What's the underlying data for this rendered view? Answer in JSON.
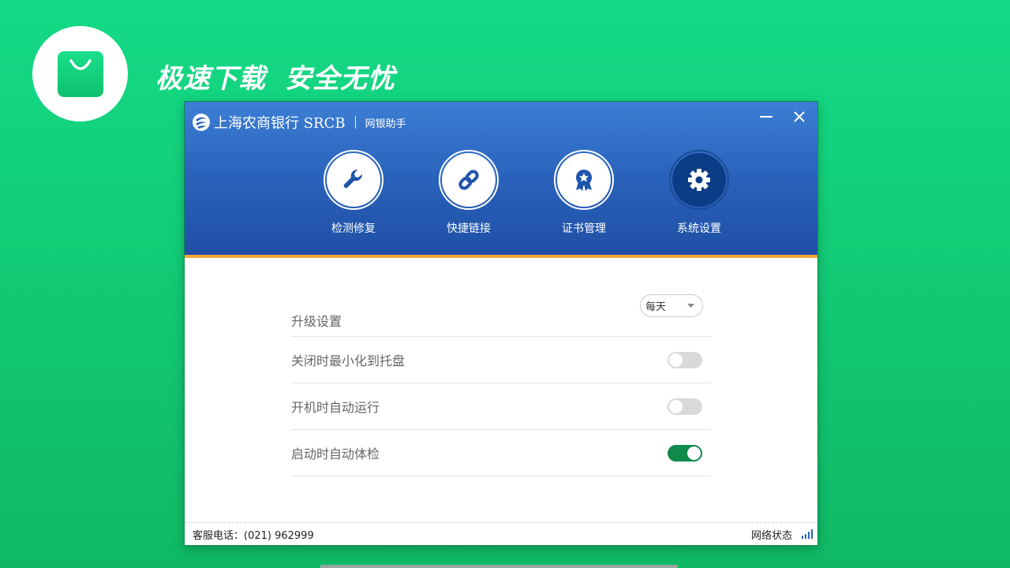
{
  "promo": {
    "slogan_left": "极速下载",
    "slogan_right": "安全无忧"
  },
  "window": {
    "brand_name": "上海农商银行 SRCB",
    "app_name": "网银助手",
    "minimize_label": "—",
    "close_label": "✕"
  },
  "nav": {
    "items": [
      {
        "label": "检测修复",
        "icon": "wrench-icon"
      },
      {
        "label": "快捷链接",
        "icon": "link-icon"
      },
      {
        "label": "证书管理",
        "icon": "certificate-badge-icon"
      },
      {
        "label": "系统设置",
        "icon": "gear-icon",
        "active": true
      }
    ]
  },
  "settings": {
    "upgrade": {
      "label": "升级设置",
      "value": "每天"
    },
    "minimize_to_tray": {
      "label": "关闭时最小化到托盘",
      "enabled": false
    },
    "autostart": {
      "label": "开机时自动运行",
      "enabled": false
    },
    "auto_check": {
      "label": "启动时自动体检",
      "enabled": true
    }
  },
  "footer": {
    "hotline": "客服电话：(021) 962999",
    "network_status": "网络状态"
  },
  "colors": {
    "background": "#12c872",
    "header_blue": "#2a62bb",
    "accent_orange": "#f3a638",
    "toggle_on": "#0f8a4c"
  }
}
